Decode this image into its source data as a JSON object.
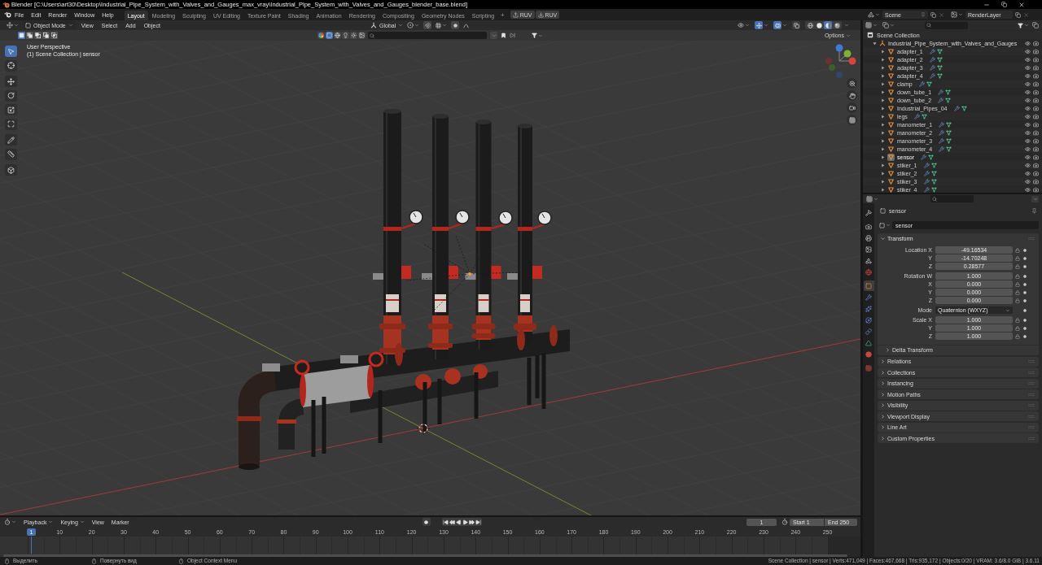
{
  "window": {
    "title": "Blender [C:\\Users\\art30\\Desktop\\Industrial_Pipe_System_with_Valves_and_Gauges_max_vray\\Industrial_Pipe_System_with_Valves_and_Gauges_blender_base.blend]"
  },
  "menu": [
    "File",
    "Edit",
    "Render",
    "Window",
    "Help"
  ],
  "workspaces": [
    {
      "label": "Layout",
      "selected": true
    },
    {
      "label": "Modeling",
      "selected": false
    },
    {
      "label": "Sculpting",
      "selected": false
    },
    {
      "label": "UV Editing",
      "selected": false
    },
    {
      "label": "Texture Paint",
      "selected": false
    },
    {
      "label": "Shading",
      "selected": false
    },
    {
      "label": "Animation",
      "selected": false
    },
    {
      "label": "Rendering",
      "selected": false
    },
    {
      "label": "Compositing",
      "selected": false
    },
    {
      "label": "Geometry Nodes",
      "selected": false
    },
    {
      "label": "Scripting",
      "selected": false
    }
  ],
  "add_workspace": "+",
  "addon_buttons": [
    "RUV",
    "RUV"
  ],
  "scene": {
    "scene": "Scene",
    "view_layer": "RenderLayer"
  },
  "viewport": {
    "mode": "Object Mode",
    "menus": [
      "View",
      "Select",
      "Add",
      "Object"
    ],
    "orientation": "Global",
    "header_toggles": [
      {
        "on": true
      },
      {
        "on": true
      },
      {
        "on": false
      }
    ],
    "shading": [
      {
        "selected": false
      },
      {
        "selected": false
      },
      {
        "selected": true
      },
      {
        "selected": false
      }
    ],
    "select_modes": [
      {
        "selected": true
      },
      {
        "selected": false
      },
      {
        "selected": false
      },
      {
        "selected": false
      },
      {
        "selected": false
      }
    ],
    "filter_buttons": [
      {
        "selected": false
      },
      {
        "selected": true
      },
      {
        "selected": false
      },
      {
        "selected": false
      },
      {
        "selected": false
      },
      {
        "selected": false
      }
    ],
    "options": "Options",
    "overlay": [
      "User Perspective",
      "(1) Scene Collection | sensor"
    ],
    "tools": [
      {
        "selected": true
      },
      {
        "selected": false
      },
      {
        "selected": false
      },
      {
        "selected": false
      },
      {
        "selected": false
      },
      {
        "selected": false
      },
      {
        "selected": false
      },
      {
        "selected": false
      },
      {
        "selected": false
      }
    ]
  },
  "outliner": {
    "root": "Scene Collection",
    "collections": [
      {
        "name": "Industrial_Pipe_System_with_Valves_and_Gauges",
        "expanded": true,
        "children": [
          {
            "name": "adapter_1",
            "selected": false,
            "expanded": false
          },
          {
            "name": "adapter_2",
            "selected": false,
            "expanded": false
          },
          {
            "name": "adapter_3",
            "selected": false,
            "expanded": false
          },
          {
            "name": "adapter_4",
            "selected": false,
            "expanded": false
          },
          {
            "name": "clamp",
            "selected": false,
            "expanded": false
          },
          {
            "name": "down_tube_1",
            "selected": false,
            "expanded": false
          },
          {
            "name": "down_tube_2",
            "selected": false,
            "expanded": false
          },
          {
            "name": "Industrial_Pipes_04",
            "selected": false,
            "expanded": false
          },
          {
            "name": "legs",
            "selected": false,
            "expanded": false
          },
          {
            "name": "manometer_1",
            "selected": false,
            "expanded": false
          },
          {
            "name": "manometer_2",
            "selected": false,
            "expanded": false
          },
          {
            "name": "manometer_3",
            "selected": false,
            "expanded": false
          },
          {
            "name": "manometer_4",
            "selected": false,
            "expanded": false
          },
          {
            "name": "sensor",
            "selected": true,
            "expanded": false
          },
          {
            "name": "stiker_1",
            "selected": false,
            "expanded": false
          },
          {
            "name": "stiker_2",
            "selected": false,
            "expanded": false
          },
          {
            "name": "stiker_3",
            "selected": false,
            "expanded": false
          },
          {
            "name": "stiker_4",
            "selected": false,
            "expanded": false
          }
        ]
      }
    ]
  },
  "properties": {
    "tabs": [
      {
        "selected": false
      },
      {
        "selected": false
      },
      {
        "selected": false
      },
      {
        "selected": false
      },
      {
        "selected": false
      },
      {
        "selected": false
      },
      {
        "selected": true
      },
      {
        "selected": false
      },
      {
        "selected": false
      },
      {
        "selected": false
      },
      {
        "selected": false
      },
      {
        "selected": false
      },
      {
        "selected": false
      },
      {
        "selected": false
      }
    ],
    "context": "sensor",
    "object_name": "sensor",
    "transform": {
      "title": "Transform",
      "expanded": true,
      "groups": [
        {
          "kind": "vector",
          "rows": [
            {
              "label": "Location X",
              "value": "-49.16534"
            },
            {
              "label": "Y",
              "value": "-14.70248"
            },
            {
              "label": "Z",
              "value": "0.28577"
            }
          ]
        },
        {
          "kind": "vector",
          "rows": [
            {
              "label": "Rotation W",
              "value": "1.000"
            },
            {
              "label": "X",
              "value": "0.000"
            },
            {
              "label": "Y",
              "value": "0.000"
            },
            {
              "label": "Z",
              "value": "0.000"
            }
          ]
        },
        {
          "kind": "dropdown",
          "rows": [
            {
              "label": "Mode",
              "value": "Quaternion (WXYZ)"
            }
          ]
        },
        {
          "kind": "vector",
          "rows": [
            {
              "label": "Scale X",
              "value": "1.000"
            },
            {
              "label": "Y",
              "value": "1.000"
            },
            {
              "label": "Z",
              "value": "1.000"
            }
          ]
        }
      ],
      "subpanels": [
        {
          "title": "Delta Transform",
          "expanded": false
        }
      ]
    },
    "panels": [
      {
        "title": "Relations",
        "expanded": false
      },
      {
        "title": "Collections",
        "expanded": false
      },
      {
        "title": "Instancing",
        "expanded": false
      },
      {
        "title": "Motion Paths",
        "expanded": false
      },
      {
        "title": "Visibility",
        "expanded": false
      },
      {
        "title": "Viewport Display",
        "expanded": false
      },
      {
        "title": "Line Art",
        "expanded": false
      },
      {
        "title": "Custom Properties",
        "expanded": false
      }
    ]
  },
  "timeline": {
    "menus": [
      {
        "label": "Playback",
        "dropdown": true
      },
      {
        "label": "Keying",
        "dropdown": true
      },
      {
        "label": "View",
        "dropdown": false
      },
      {
        "label": "Marker",
        "dropdown": false
      }
    ],
    "current_frame": "1",
    "start_label": "Start",
    "start": "1",
    "end_label": "End",
    "end": "250",
    "playhead": "1",
    "ticks": [
      "10",
      "20",
      "30",
      "40",
      "50",
      "60",
      "70",
      "80",
      "90",
      "100",
      "110",
      "120",
      "130",
      "140",
      "150",
      "160",
      "170",
      "180",
      "190",
      "200",
      "210",
      "220",
      "230",
      "240",
      "250"
    ]
  },
  "status_bar": {
    "hints": [
      "Выделить",
      "Повернуть вид",
      "Object Context Menu"
    ],
    "stats": "Scene Collection | sensor | Verts:471,049 | Faces:467,668 | Tris:935,172 | Objects:0/20 | VRAM: 3.6/8.0 GiB | 3.6.11"
  }
}
